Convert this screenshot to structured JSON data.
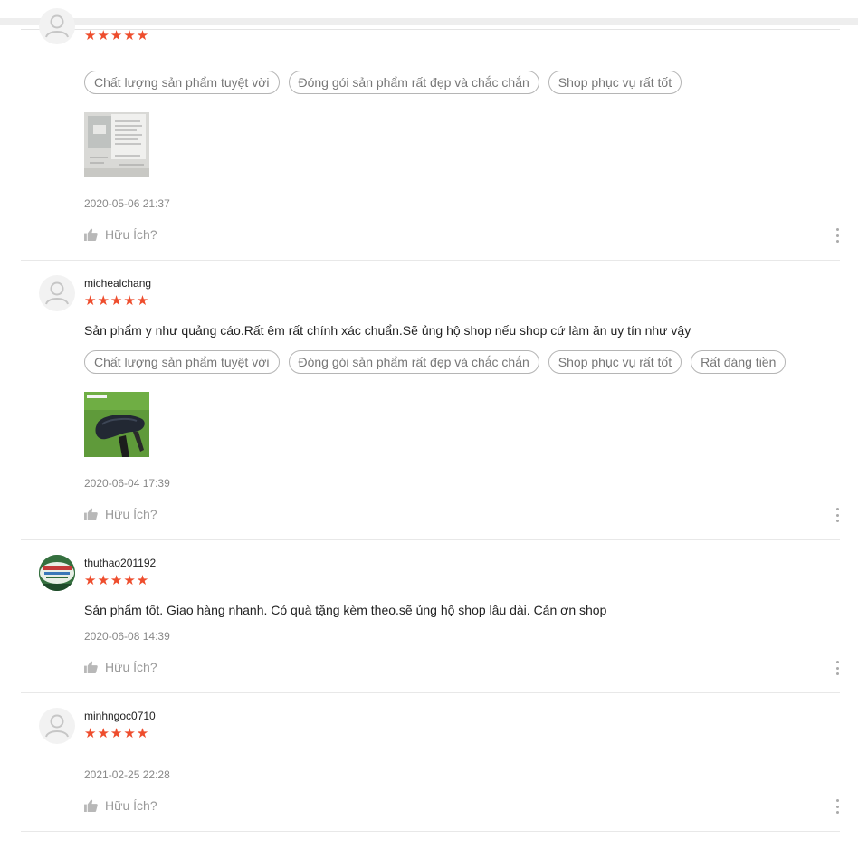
{
  "reviews": [
    {
      "username": "",
      "stars": "★★★★★",
      "comment": "",
      "tags": [
        "Chất lượng sản phẩm tuyệt vời",
        "Đóng gói sản phẩm rất đẹp và chắc chắn",
        "Shop phục vụ rất tốt"
      ],
      "timestamp": "2020-05-06 21:37",
      "helpful": "Hữu Ích?"
    },
    {
      "username": "michealchang",
      "stars": "★★★★★",
      "comment": "Sản phẩm y như quảng cáo.Rất êm rất chính xác chuẩn.Sẽ ủng hộ shop nếu shop cứ làm ăn uy tín như vậy",
      "tags": [
        "Chất lượng sản phẩm tuyệt vời",
        "Đóng gói sản phẩm rất đẹp và chắc chắn",
        "Shop phục vụ rất tốt",
        "Rất đáng tiền"
      ],
      "timestamp": "2020-06-04 17:39",
      "helpful": "Hữu Ích?"
    },
    {
      "username": "thuthao201192",
      "stars": "★★★★★",
      "comment": "Sản phẩm tốt. Giao hàng nhanh. Có quà tặng kèm theo.sẽ ủng hộ shop lâu dài. Cản ơn shop",
      "tags": [],
      "timestamp": "2020-06-08 14:39",
      "helpful": "Hữu Ích?"
    },
    {
      "username": "minhngoc0710",
      "stars": "★★★★★",
      "comment": "",
      "tags": [],
      "timestamp": "2021-02-25 22:28",
      "helpful": "Hữu Ích?"
    }
  ],
  "colors": {
    "star": "#ee4d2d",
    "tag_border": "#b5b5b5",
    "muted_text": "#888888"
  },
  "icons": [
    "default-avatar-icon",
    "thumbs-up-icon",
    "more-options-icon"
  ]
}
